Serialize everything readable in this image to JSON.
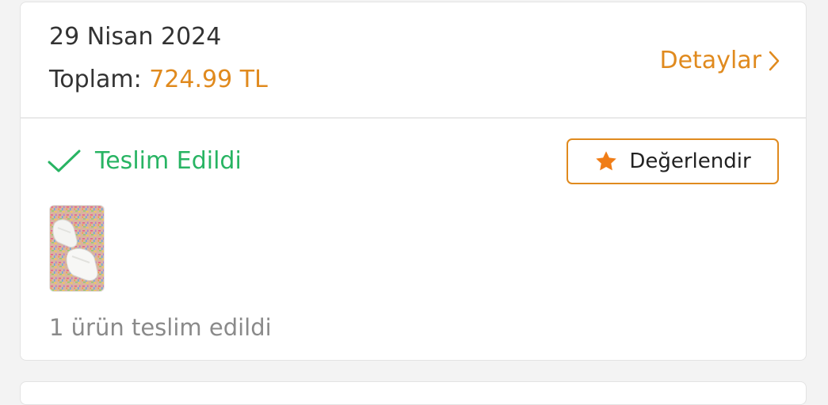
{
  "order": {
    "date": "29 Nisan 2024",
    "total_label": "Toplam:",
    "total_amount": "724.99 TL",
    "details_label": "Detaylar",
    "status_text": "Teslim Edildi",
    "rate_button_label": "Değerlendir",
    "delivered_summary": "1 ürün teslim edildi",
    "product_image_icon": "sneaker-product-photo"
  },
  "colors": {
    "accent": "#e08a1e",
    "success": "#28b463",
    "text_primary": "#333333",
    "text_muted": "#8a8a8a",
    "background": "#f3f3f3"
  },
  "icons": {
    "details": "chevron-right-icon",
    "status": "checkmark-icon",
    "rate": "star-icon"
  }
}
